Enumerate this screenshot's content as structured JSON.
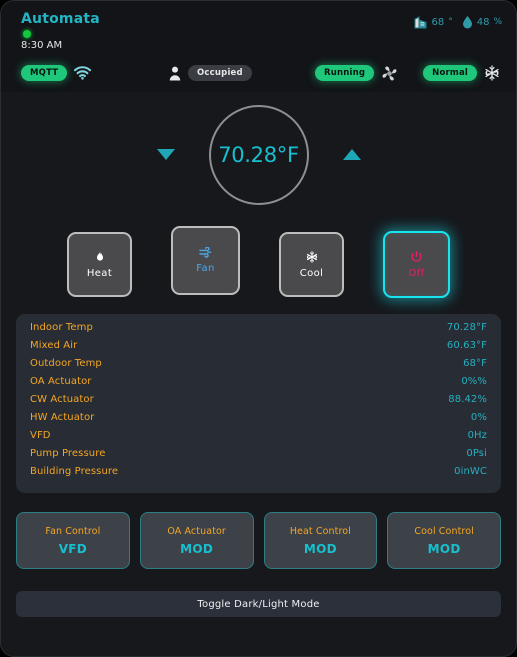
{
  "header": {
    "brand_title": "Automata",
    "status_dot": "online",
    "time": "8:30 AM",
    "env": [
      {
        "icon": "building-icon",
        "value": "68",
        "unit": "°"
      },
      {
        "icon": "water-drop-icon",
        "value": "48",
        "unit": "%"
      }
    ],
    "statuses": [
      {
        "pill": "MQTT",
        "style": "green",
        "icon": "wifi-icon",
        "icon_side": "right"
      },
      {
        "pill": "Occupied",
        "style": "grey",
        "icon": "person-icon",
        "icon_side": "left"
      },
      {
        "pill": "Running",
        "style": "green",
        "icon": "fan-icon",
        "icon_side": "right"
      },
      {
        "pill": "Normal",
        "style": "green",
        "icon": "snowflake-icon",
        "icon_side": "right"
      }
    ]
  },
  "dial": {
    "temperature": "70.28°F",
    "decrease_icon": "chevron-down-icon",
    "increase_icon": "chevron-up-icon"
  },
  "modes": [
    {
      "label": "Heat",
      "icon": "flame-icon",
      "active": false
    },
    {
      "label": "Fan",
      "icon": "fan-blade-icon",
      "active": false
    },
    {
      "label": "Cool",
      "icon": "snowflake-icon",
      "active": false
    },
    {
      "label": "Off",
      "icon": "power-icon",
      "active": true
    }
  ],
  "readings": [
    {
      "label": "Indoor Temp",
      "value": "70.28°F"
    },
    {
      "label": "Mixed Air",
      "value": "60.63°F"
    },
    {
      "label": "Outdoor Temp",
      "value": "68°F"
    },
    {
      "label": "OA Actuator",
      "value": "0%%"
    },
    {
      "label": "CW Actuator",
      "value": "88.42%"
    },
    {
      "label": "HW Actuator",
      "value": "0%"
    },
    {
      "label": "VFD",
      "value": "0Hz"
    },
    {
      "label": "Pump Pressure",
      "value": "0Psi"
    },
    {
      "label": "Building Pressure",
      "value": "0inWC"
    }
  ],
  "controls": [
    {
      "label": "Fan Control",
      "value": "VFD"
    },
    {
      "label": "OA Actuator",
      "value": "MOD"
    },
    {
      "label": "Heat Control",
      "value": "MOD"
    },
    {
      "label": "Cool Control",
      "value": "MOD"
    }
  ],
  "toggle": {
    "label": "Toggle Dark/Light Mode"
  },
  "colors": {
    "accent_teal": "#17c0cf",
    "accent_orange": "#f5a623",
    "accent_green": "#1fc77a",
    "accent_pink": "#ea1e63",
    "highlight_cyan": "#18e4f0",
    "page_bg": "#16181c",
    "panel_bg": "#272c35"
  }
}
